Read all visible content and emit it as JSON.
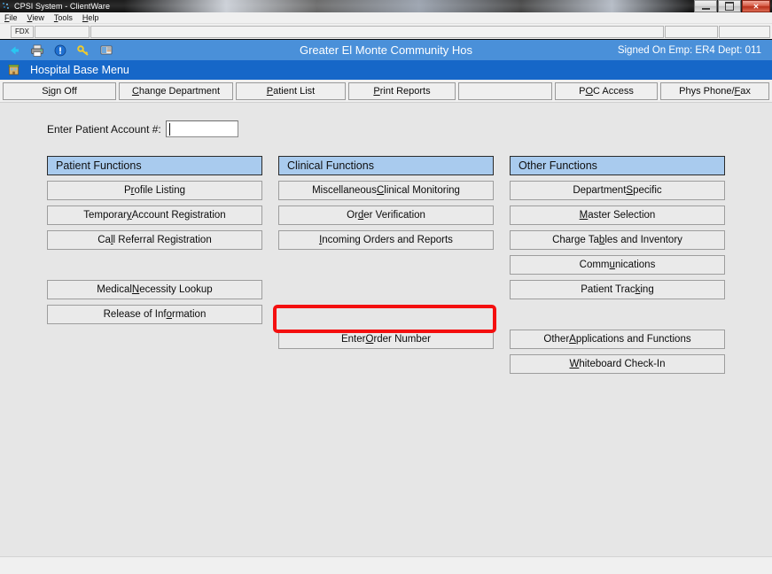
{
  "window": {
    "title": "CPSI System - ClientWare",
    "controls": {
      "minimize": "minimize",
      "maximize": "maximize",
      "close": "✕"
    }
  },
  "menubar": {
    "items": [
      {
        "label": "File",
        "accel": "F"
      },
      {
        "label": "View",
        "accel": "V"
      },
      {
        "label": "Tools",
        "accel": "T"
      },
      {
        "label": "Help",
        "accel": "H"
      }
    ]
  },
  "statusbar": {
    "fdx": "FDX"
  },
  "toolbar": {
    "icons": [
      "back-arrow-icon",
      "printer-icon",
      "info-icon",
      "key-icon",
      "screen-icon"
    ],
    "center_title": "Greater El Monte Community Hos",
    "signed_on": "Signed On Emp: ER4  Dept: 011"
  },
  "menu_title": {
    "label": "Hospital Base Menu",
    "icon": "building-icon"
  },
  "button_toolbar": {
    "buttons": [
      {
        "pre": "S",
        "accel": "i",
        "post": "gn Off"
      },
      {
        "pre": "",
        "accel": "C",
        "post": "hange Department"
      },
      {
        "pre": "",
        "accel": "P",
        "post": "atient List"
      },
      {
        "pre": "",
        "accel": "P",
        "post": "rint Reports"
      },
      {
        "pre": "P",
        "accel": "O",
        "post": "C Access"
      },
      {
        "pre": "Phys Phone/",
        "accel": "F",
        "post": "ax"
      }
    ]
  },
  "account": {
    "label": "Enter Patient Account #:",
    "value": "",
    "placeholder": ""
  },
  "columns": [
    {
      "header": "Patient Functions",
      "buttons": [
        {
          "pre": "P",
          "accel": "r",
          "post": "ofile Listing"
        },
        {
          "pre": "Temporar",
          "accel": "y",
          "post": " Account Registration"
        },
        {
          "pre": "Ca",
          "accel": "l",
          "post": "l Referral Registration"
        },
        {
          "spacer": true
        },
        {
          "pre": "Medical ",
          "accel": "N",
          "post": "ecessity Lookup"
        },
        {
          "pre": "Release of Inf",
          "accel": "o",
          "post": "rmation"
        }
      ]
    },
    {
      "header": "Clinical Functions",
      "buttons": [
        {
          "pre": "Miscellaneous ",
          "accel": "C",
          "post": "linical Monitoring"
        },
        {
          "pre": "Or",
          "accel": "d",
          "post": "er Verification",
          "highlighted": true
        },
        {
          "pre": "",
          "accel": "I",
          "post": "ncoming Orders and Reports"
        },
        {
          "spacer": true
        },
        {
          "spacer": true
        },
        {
          "spacer": true
        },
        {
          "pre": "Enter ",
          "accel": "O",
          "post": "rder Number"
        }
      ]
    },
    {
      "header": "Other Functions",
      "buttons": [
        {
          "pre": "Department ",
          "accel": "S",
          "post": "pecific"
        },
        {
          "pre": "",
          "accel": "M",
          "post": "aster Selection"
        },
        {
          "pre": "Charge Ta",
          "accel": "b",
          "post": "les and Inventory"
        },
        {
          "pre": "Comm",
          "accel": "u",
          "post": "nications"
        },
        {
          "pre": "Patient Trac",
          "accel": "k",
          "post": "ing"
        },
        {
          "spacer": true
        },
        {
          "pre": "Other ",
          "accel": "A",
          "post": "pplications and Functions"
        },
        {
          "pre": "",
          "accel": "W",
          "post": "hiteboard Check-In"
        }
      ]
    }
  ],
  "highlight": {
    "color": "#f40f0f",
    "target": "Order Verification"
  }
}
